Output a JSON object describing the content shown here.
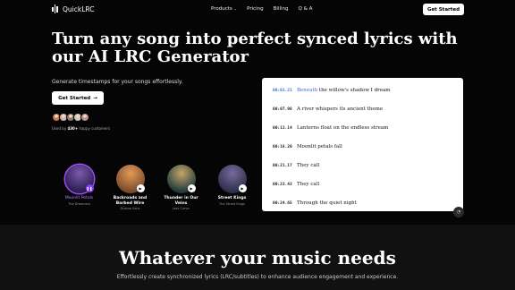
{
  "nav": {
    "brand": "QuickLRC",
    "items": [
      {
        "label": "Products",
        "has_dropdown": true
      },
      {
        "label": "Pricing"
      },
      {
        "label": "Billing"
      },
      {
        "label": "Q & A"
      }
    ],
    "cta": "Get Started"
  },
  "hero": {
    "headline": "Turn any song into perfect synced lyrics with our AI LRC Generator",
    "subheadline": "Generate timestamps for your songs effortlessly.",
    "cta": "Get Started",
    "used_prefix": "Used by ",
    "used_count": "430+",
    "used_suffix": " happy customers",
    "avatar_colors": [
      "#c8764b",
      "#d3b3a6",
      "#8e7a6a",
      "#cfc7c0",
      "#b59287"
    ]
  },
  "albums": [
    {
      "title": "Moonlit Petals",
      "artist": "The Dreamers",
      "active": true,
      "colors": [
        "#2a1c4e",
        "#7a5bb0"
      ]
    },
    {
      "title": "Backroads and Barbed Wire",
      "artist": "Dustoa Sons",
      "active": false,
      "colors": [
        "#7a4a2e",
        "#e29a55"
      ]
    },
    {
      "title": "Thunder in Our Veins",
      "artist": "Jazz Curve",
      "active": false,
      "colors": [
        "#1f3a3a",
        "#c6a56a"
      ]
    },
    {
      "title": "Street Kings",
      "artist": "The Street Kings",
      "active": false,
      "colors": [
        "#2b2f4a",
        "#7a6a9c"
      ]
    }
  ],
  "lyrics": [
    {
      "time": "00:01.21",
      "highlight": "Beneath",
      "text": " the willow's shadow I dream",
      "active": true
    },
    {
      "time": "00:07.98",
      "highlight": "",
      "text": "A river whispers its ancient theme",
      "active": false
    },
    {
      "time": "00:13.14",
      "highlight": "",
      "text": "Lanterns float on the endless stream",
      "active": false
    },
    {
      "time": "00:18.20",
      "highlight": "",
      "text": "Moonlit petals fall",
      "active": false
    },
    {
      "time": "00:21.17",
      "highlight": "",
      "text": "They call",
      "active": false
    },
    {
      "time": "00:23.43",
      "highlight": "",
      "text": "They call",
      "active": false
    },
    {
      "time": "00:24.65",
      "highlight": "",
      "text": "Through the quiet night",
      "active": false
    }
  ],
  "section2": {
    "title": "Whatever your music needs",
    "subtitle": "Effortlessly create synchronized lyrics (LRC/subtitles) to enhance audience engagement and experience."
  },
  "colors": {
    "accent": "#3a6fd8",
    "purple": "#a64cff",
    "background": "#050505"
  }
}
